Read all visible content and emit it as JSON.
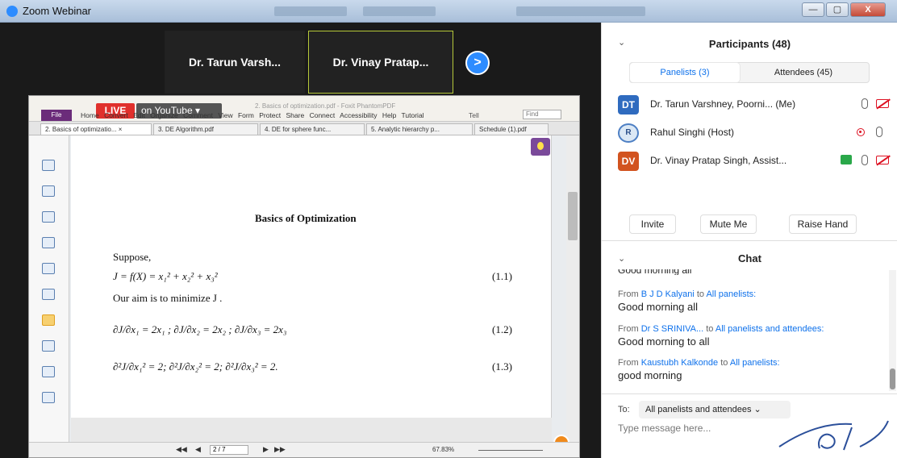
{
  "window": {
    "app_title": "Zoom Webinar",
    "controls": {
      "minimize": "—",
      "maximize": "▢",
      "close": "X"
    }
  },
  "speakers": {
    "tile1": "Dr. Tarun Varsh...",
    "tile2": "Dr. Vinay Pratap...",
    "next": ">"
  },
  "pdf": {
    "live_badge": "LIVE",
    "youtube_badge": "on YouTube ▾",
    "file_button": "File",
    "doc_title": "2. Basics of optimization.pdf - Foxit PhantomPDF",
    "menu": [
      "Home",
      "Convert",
      "Edit",
      "Organize",
      "Comment",
      "View",
      "Form",
      "Protect",
      "Share",
      "Connect",
      "Accessibility",
      "Help",
      "Tutorial"
    ],
    "tell_label": "Tell",
    "find_placeholder": "Find",
    "tabs": [
      "2. Basics of optimizatio... ×",
      "3. DE Algorithm.pdf",
      "4. DE for sphere func...",
      "5. Analytic hierarchy p...",
      "Schedule (1).pdf"
    ],
    "page": {
      "title": "Basics of Optimization",
      "suppose": "Suppose,",
      "eq1": "J = f(X) = x₁² + x₂² + x₃²",
      "eq1_num": "(1.1)",
      "aim": "Our aim is to minimize J .",
      "eq2": "∂J/∂x₁ = 2x₁ ;   ∂J/∂x₂ = 2x₂ ;   ∂J/∂x₃ = 2x₃",
      "eq2_num": "(1.2)",
      "eq3": "∂²J/∂x₁² = 2;   ∂²J/∂x₂² = 2;   ∂²J/∂x₃² = 2.",
      "eq3_num": "(1.3)"
    },
    "status": {
      "page_indicator": "2 / 7",
      "zoom": "67.83%",
      "nav_first": "◀◀",
      "nav_prev": "◀",
      "nav_next": "▶",
      "nav_last": "▶▶"
    }
  },
  "participants": {
    "title": "Participants (48)",
    "tab_panelists": "Panelists (3)",
    "tab_attendees": "Attendees (45)",
    "list": [
      {
        "initials": "DT",
        "name": "Dr. Tarun Varshney, Poorni...  (Me)"
      },
      {
        "initials": "R",
        "name": "Rahul Singhi (Host)"
      },
      {
        "initials": "DV",
        "name": "Dr. Vinay Pratap Singh, Assist..."
      }
    ],
    "buttons": {
      "invite": "Invite",
      "mute": "Mute Me",
      "raise": "Raise Hand"
    }
  },
  "chat": {
    "title": "Chat",
    "collapse": "⌄",
    "cut_line": "Good morning all",
    "messages": [
      {
        "from_label": "From",
        "sender": "B J D Kalyani",
        "to_label": "to",
        "recipient": "All panelists:",
        "body": "Good morning all"
      },
      {
        "from_label": "From",
        "sender": "Dr S SRINIVA...",
        "to_label": "to",
        "recipient": "All panelists and attendees:",
        "body": "Good morning to all"
      },
      {
        "from_label": "From",
        "sender": "Kaustubh Kalkonde",
        "to_label": "to",
        "recipient": "All panelists:",
        "body": "good morning"
      }
    ],
    "to_label": "To:",
    "to_value": "All panelists and attendees ⌄",
    "input_placeholder": "Type message here..."
  },
  "colors": {
    "zoom_blue": "#0e71eb",
    "live_red": "#e0302c",
    "avatar_dt": "#2f6bbf",
    "avatar_dv": "#d2531f"
  }
}
